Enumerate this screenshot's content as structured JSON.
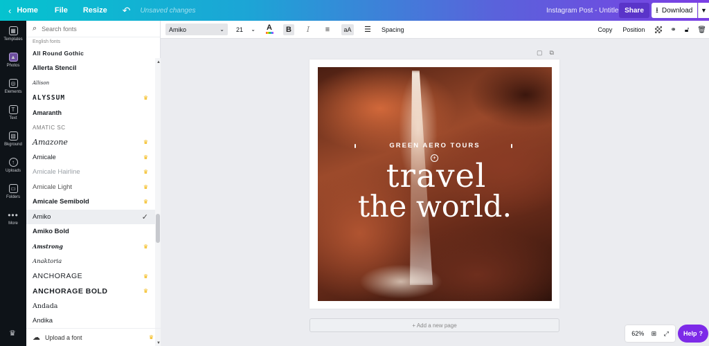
{
  "topbar": {
    "home_label": "Home",
    "file_label": "File",
    "resize_label": "Resize",
    "unsaved_label": "Unsaved changes",
    "doc_title": "Instagram Post - Untitled",
    "share_label": "Share",
    "download_label": "Download"
  },
  "rail": {
    "items": [
      {
        "label": "Templates",
        "icon": "templates-icon"
      },
      {
        "label": "Photos",
        "icon": "photos-icon"
      },
      {
        "label": "Elements",
        "icon": "elements-icon"
      },
      {
        "label": "Text",
        "icon": "text-icon"
      },
      {
        "label": "Bkground",
        "icon": "background-icon"
      },
      {
        "label": "Uploads",
        "icon": "uploads-icon"
      },
      {
        "label": "Folders",
        "icon": "folders-icon"
      },
      {
        "label": "More",
        "icon": "more-icon"
      }
    ]
  },
  "font_panel": {
    "search_placeholder": "Search fonts",
    "section_label": "English fonts",
    "fonts": [
      {
        "name": "All Round Gothic",
        "premium": false
      },
      {
        "name": "Allerta Stencil",
        "premium": false
      },
      {
        "name": "Allison",
        "premium": false
      },
      {
        "name": "ALYSSUM",
        "premium": true
      },
      {
        "name": "Amaranth",
        "premium": false
      },
      {
        "name": "Amatic SC",
        "premium": false
      },
      {
        "name": "Amazone",
        "premium": true
      },
      {
        "name": "Amicale",
        "premium": true
      },
      {
        "name": "Amicale Hairline",
        "premium": true
      },
      {
        "name": "Amicale Light",
        "premium": true
      },
      {
        "name": "Amicale Semibold",
        "premium": true
      },
      {
        "name": "Amiko",
        "premium": false,
        "selected": true
      },
      {
        "name": "Amiko Bold",
        "premium": false
      },
      {
        "name": "Amstrong",
        "premium": true
      },
      {
        "name": "Anaktoria",
        "premium": false
      },
      {
        "name": "ANCHORAGE",
        "premium": true
      },
      {
        "name": "ANCHORAGE BOLD",
        "premium": true
      },
      {
        "name": "Andada",
        "premium": false
      },
      {
        "name": "Andika",
        "premium": false
      }
    ],
    "upload_label": "Upload a font"
  },
  "toolbar": {
    "font_value": "Amiko",
    "size_value": "21",
    "spacing_label": "Spacing",
    "copy_label": "Copy",
    "position_label": "Position"
  },
  "design": {
    "tagline": "GREEN AERO TOURS",
    "headline_line1": "travel",
    "headline_line2": "the world."
  },
  "canvas": {
    "add_page_label": "+ Add a new page"
  },
  "bottom": {
    "zoom": "62%",
    "help_label": "Help"
  },
  "colors": {
    "accent": "#7d2ae8",
    "premium_crown": "#f2b300",
    "rail_bg": "#0e1318"
  }
}
